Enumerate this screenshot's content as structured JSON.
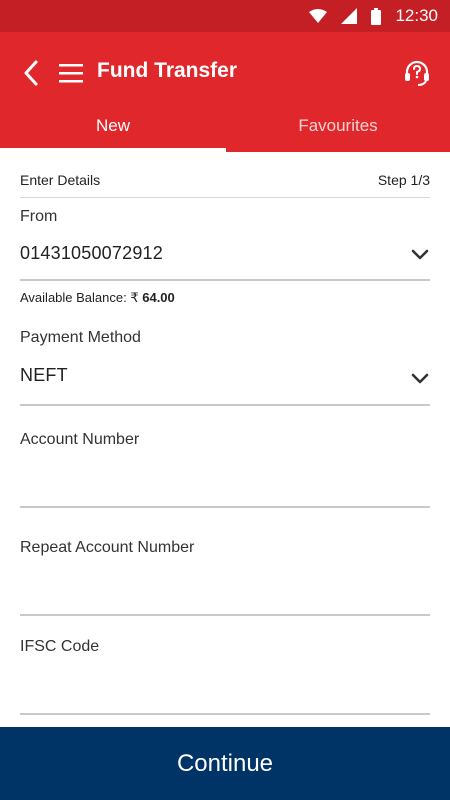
{
  "status_bar": {
    "time": "12:30"
  },
  "app_bar": {
    "title": "Fund Transfer"
  },
  "tabs": [
    {
      "label": "New"
    },
    {
      "label": "Favourites"
    }
  ],
  "form": {
    "header_left": "Enter Details",
    "step": "Step 1/3",
    "from_label": "From",
    "from_value": "01431050072912",
    "balance_label": "Available Balance: ₹",
    "balance_value": "64.00",
    "payment_label": "Payment Method",
    "payment_value": "NEFT",
    "account_label": "Account Number",
    "repeat_label": "Repeat Account Number",
    "ifsc_label": "IFSC Code"
  },
  "continue_label": "Continue",
  "colors": {
    "header_red": "#e0282c",
    "status_red": "#c41f24",
    "continue_navy": "#003366"
  }
}
